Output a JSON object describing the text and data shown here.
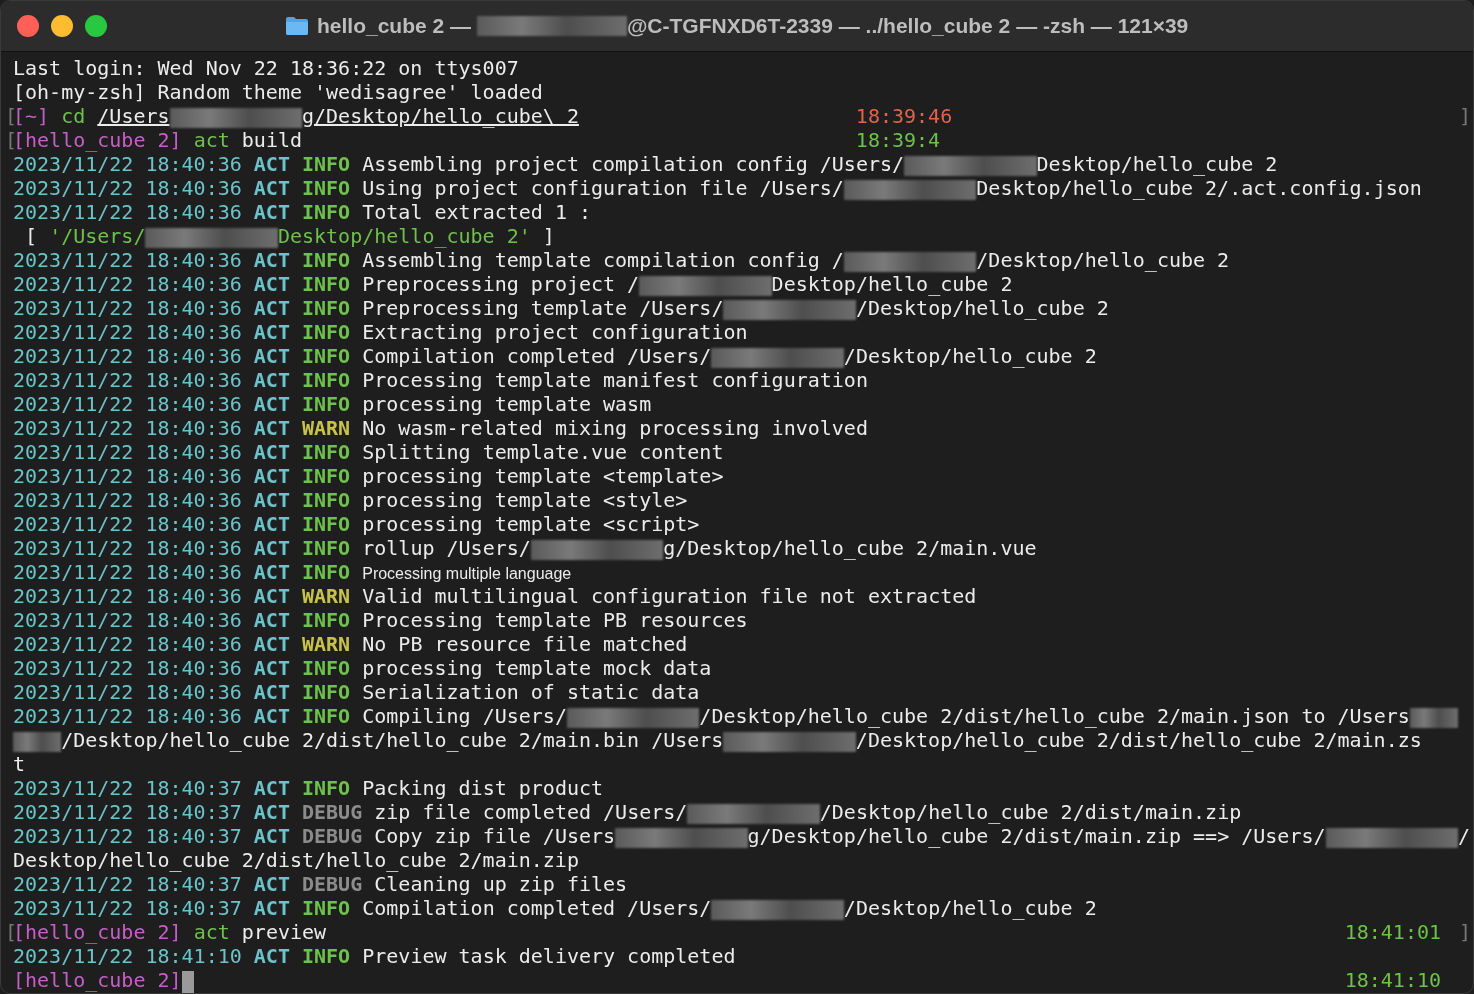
{
  "window": {
    "title_parts": [
      {
        "kind": "text",
        "text": "hello_cube 2 — "
      },
      {
        "kind": "redacted"
      },
      {
        "kind": "text",
        "text": "@C-TGFNXD6T-2339 — ../hello_cube 2 — -zsh — 121×39"
      }
    ]
  },
  "lines": [
    {
      "kind": "text",
      "parts": [
        {
          "kind": "text",
          "text": "Last login: Wed Nov 22 18:36:22 on ttys007"
        }
      ]
    },
    {
      "kind": "text",
      "parts": [
        {
          "kind": "text",
          "text": "[oh-my-zsh] Random theme 'wedisagree' loaded"
        }
      ]
    },
    {
      "kind": "prompt_narrow",
      "lbracket": "[",
      "dir": "[~]",
      "command": "cd",
      "args": [
        {
          "kind": "text",
          "text": "/Users",
          "underlined": true
        },
        {
          "kind": "redacted"
        },
        {
          "kind": "text",
          "text": "g/Desktop/hello_cube\\ 2",
          "underlined": true
        }
      ],
      "time": {
        "text": "18:39:46",
        "color": "#e0644c"
      },
      "rbracket": "]"
    },
    {
      "kind": "prompt_narrow",
      "lbracket": "[",
      "dir": "[hello_cube 2]",
      "command": "act",
      "args": [
        {
          "kind": "text",
          "text": "build",
          "underlined": false
        }
      ],
      "time": {
        "text": "18:39:4",
        "color": "#6cc24a"
      }
    },
    {
      "kind": "log",
      "time": "2023/11/22 18:40:36",
      "source": "ACT",
      "severity": {
        "label": "INFO",
        "color": "#6cc24a"
      },
      "parts": [
        {
          "kind": "text",
          "text": "Assembling project compilation config /Users/"
        },
        {
          "kind": "redacted"
        },
        {
          "kind": "text",
          "text": "Desktop/hello_cube 2"
        }
      ]
    },
    {
      "kind": "log",
      "time": "2023/11/22 18:40:36",
      "source": "ACT",
      "severity": {
        "label": "INFO",
        "color": "#6cc24a"
      },
      "parts": [
        {
          "kind": "text",
          "text": "Using project configuration file /Users/"
        },
        {
          "kind": "redacted"
        },
        {
          "kind": "text",
          "text": "Desktop/hello_cube 2/.act.config.json"
        }
      ]
    },
    {
      "kind": "log",
      "time": "2023/11/22 18:40:36",
      "source": "ACT",
      "severity": {
        "label": "INFO",
        "color": "#6cc24a"
      },
      "parts": [
        {
          "kind": "text",
          "text": "Total extracted 1 :"
        }
      ]
    },
    {
      "kind": "text",
      "parts": [
        {
          "kind": "text",
          "text": " [ "
        },
        {
          "kind": "text",
          "text": "'/Users/",
          "color": "#6cc24a"
        },
        {
          "kind": "redacted"
        },
        {
          "kind": "text",
          "text": "Desktop/hello_cube 2'",
          "color": "#6cc24a"
        },
        {
          "kind": "text",
          "text": " ]"
        }
      ]
    },
    {
      "kind": "log",
      "time": "2023/11/22 18:40:36",
      "source": "ACT",
      "severity": {
        "label": "INFO",
        "color": "#6cc24a"
      },
      "parts": [
        {
          "kind": "text",
          "text": "Assembling template compilation config /"
        },
        {
          "kind": "redacted"
        },
        {
          "kind": "text",
          "text": "/Desktop/hello_cube 2"
        }
      ]
    },
    {
      "kind": "log",
      "time": "2023/11/22 18:40:36",
      "source": "ACT",
      "severity": {
        "label": "INFO",
        "color": "#6cc24a"
      },
      "parts": [
        {
          "kind": "text",
          "text": "Preprocessing project /"
        },
        {
          "kind": "redacted"
        },
        {
          "kind": "text",
          "text": "Desktop/hello_cube 2"
        }
      ]
    },
    {
      "kind": "log",
      "time": "2023/11/22 18:40:36",
      "source": "ACT",
      "severity": {
        "label": "INFO",
        "color": "#6cc24a"
      },
      "parts": [
        {
          "kind": "text",
          "text": "Preprocessing template /Users/"
        },
        {
          "kind": "redacted"
        },
        {
          "kind": "text",
          "text": "/Desktop/hello_cube 2"
        }
      ]
    },
    {
      "kind": "log",
      "time": "2023/11/22 18:40:36",
      "source": "ACT",
      "severity": {
        "label": "INFO",
        "color": "#6cc24a"
      },
      "parts": [
        {
          "kind": "text",
          "text": "Extracting project configuration"
        }
      ]
    },
    {
      "kind": "log",
      "time": "2023/11/22 18:40:36",
      "source": "ACT",
      "severity": {
        "label": "INFO",
        "color": "#6cc24a"
      },
      "parts": [
        {
          "kind": "text",
          "text": "Compilation completed /Users/"
        },
        {
          "kind": "redacted"
        },
        {
          "kind": "text",
          "text": "/Desktop/hello_cube 2"
        }
      ]
    },
    {
      "kind": "log",
      "time": "2023/11/22 18:40:36",
      "source": "ACT",
      "severity": {
        "label": "INFO",
        "color": "#6cc24a"
      },
      "parts": [
        {
          "kind": "text",
          "text": "Processing template manifest configuration"
        }
      ]
    },
    {
      "kind": "log",
      "time": "2023/11/22 18:40:36",
      "source": "ACT",
      "severity": {
        "label": "INFO",
        "color": "#6cc24a"
      },
      "parts": [
        {
          "kind": "text",
          "text": "processing template wasm"
        }
      ]
    },
    {
      "kind": "log",
      "time": "2023/11/22 18:40:36",
      "source": "ACT",
      "severity": {
        "label": "WARN",
        "color": "#c9c24a"
      },
      "parts": [
        {
          "kind": "text",
          "text": "No wasm-related mixing processing involved"
        }
      ]
    },
    {
      "kind": "log",
      "time": "2023/11/22 18:40:36",
      "source": "ACT",
      "severity": {
        "label": "INFO",
        "color": "#6cc24a"
      },
      "parts": [
        {
          "kind": "text",
          "text": "Splitting template.vue content"
        }
      ]
    },
    {
      "kind": "log",
      "time": "2023/11/22 18:40:36",
      "source": "ACT",
      "severity": {
        "label": "INFO",
        "color": "#6cc24a"
      },
      "parts": [
        {
          "kind": "text",
          "text": "processing template <template>"
        }
      ]
    },
    {
      "kind": "log",
      "time": "2023/11/22 18:40:36",
      "source": "ACT",
      "severity": {
        "label": "INFO",
        "color": "#6cc24a"
      },
      "parts": [
        {
          "kind": "text",
          "text": "processing template <style>"
        }
      ]
    },
    {
      "kind": "log",
      "time": "2023/11/22 18:40:36",
      "source": "ACT",
      "severity": {
        "label": "INFO",
        "color": "#6cc24a"
      },
      "parts": [
        {
          "kind": "text",
          "text": "processing template <script>"
        }
      ]
    },
    {
      "kind": "log",
      "time": "2023/11/22 18:40:36",
      "source": "ACT",
      "severity": {
        "label": "INFO",
        "color": "#6cc24a"
      },
      "parts": [
        {
          "kind": "text",
          "text": "rollup /Users/"
        },
        {
          "kind": "redacted"
        },
        {
          "kind": "text",
          "text": "g/Desktop/hello_cube 2/main.vue"
        }
      ]
    },
    {
      "kind": "log",
      "time": "2023/11/22 18:40:36",
      "source": "ACT",
      "severity": {
        "label": "INFO",
        "color": "#6cc24a"
      },
      "parts": [
        {
          "kind": "sans",
          "text": "Processing multiple language"
        }
      ]
    },
    {
      "kind": "log",
      "time": "2023/11/22 18:40:36",
      "source": "ACT",
      "severity": {
        "label": "WARN",
        "color": "#c9c24a"
      },
      "parts": [
        {
          "kind": "text",
          "text": "Valid multilingual configuration file not extracted"
        }
      ]
    },
    {
      "kind": "log",
      "time": "2023/11/22 18:40:36",
      "source": "ACT",
      "severity": {
        "label": "INFO",
        "color": "#6cc24a"
      },
      "parts": [
        {
          "kind": "text",
          "text": "Processing template PB resources"
        }
      ]
    },
    {
      "kind": "log",
      "time": "2023/11/22 18:40:36",
      "source": "ACT",
      "severity": {
        "label": "WARN",
        "color": "#c9c24a"
      },
      "parts": [
        {
          "kind": "text",
          "text": "No PB resource file matched"
        }
      ]
    },
    {
      "kind": "log",
      "time": "2023/11/22 18:40:36",
      "source": "ACT",
      "severity": {
        "label": "INFO",
        "color": "#6cc24a"
      },
      "parts": [
        {
          "kind": "text",
          "text": "processing template mock data"
        }
      ]
    },
    {
      "kind": "log",
      "time": "2023/11/22 18:40:36",
      "source": "ACT",
      "severity": {
        "label": "INFO",
        "color": "#6cc24a"
      },
      "parts": [
        {
          "kind": "text",
          "text": "Serialization of static data"
        }
      ]
    },
    {
      "kind": "log",
      "time": "2023/11/22 18:40:36",
      "source": "ACT",
      "severity": {
        "label": "INFO",
        "color": "#6cc24a"
      },
      "parts": [
        {
          "kind": "text",
          "text": "Compiling /Users/"
        },
        {
          "kind": "redacted"
        },
        {
          "kind": "text",
          "text": "/Desktop/hello_cube 2/dist/hello_cube 2/main.json to /Users"
        },
        {
          "kind": "redacted_short"
        }
      ]
    },
    {
      "kind": "text",
      "parts": [
        {
          "kind": "redacted_short"
        },
        {
          "kind": "text",
          "text": "/Desktop/hello_cube 2/dist/hello_cube 2/main.bin /Users"
        },
        {
          "kind": "redacted"
        },
        {
          "kind": "text",
          "text": "/Desktop/hello_cube 2/dist/hello_cube 2/main.zs"
        }
      ]
    },
    {
      "kind": "text",
      "parts": [
        {
          "kind": "text",
          "text": "t"
        }
      ]
    },
    {
      "kind": "log",
      "time": "2023/11/22 18:40:37",
      "source": "ACT",
      "severity": {
        "label": "INFO",
        "color": "#6cc24a"
      },
      "parts": [
        {
          "kind": "text",
          "text": "Packing dist product"
        }
      ]
    },
    {
      "kind": "log",
      "time": "2023/11/22 18:40:37",
      "source": "ACT",
      "severity": {
        "label": "DEBUG",
        "color": "#8c8c8c"
      },
      "parts": [
        {
          "kind": "text",
          "text": "zip file completed /Users/"
        },
        {
          "kind": "redacted"
        },
        {
          "kind": "text",
          "text": "/Desktop/hello_cube 2/dist/main.zip"
        }
      ]
    },
    {
      "kind": "log",
      "time": "2023/11/22 18:40:37",
      "source": "ACT",
      "severity": {
        "label": "DEBUG",
        "color": "#8c8c8c"
      },
      "parts": [
        {
          "kind": "text",
          "text": "Copy zip file /Users"
        },
        {
          "kind": "redacted"
        },
        {
          "kind": "text",
          "text": "g/Desktop/hello_cube 2/dist/main.zip ==> /Users/"
        },
        {
          "kind": "redacted"
        },
        {
          "kind": "text",
          "text": "/"
        }
      ]
    },
    {
      "kind": "text",
      "parts": [
        {
          "kind": "text",
          "text": "Desktop/hello_cube 2/dist/hello_cube 2/main.zip"
        }
      ]
    },
    {
      "kind": "log",
      "time": "2023/11/22 18:40:37",
      "source": "ACT",
      "severity": {
        "label": "DEBUG",
        "color": "#8c8c8c"
      },
      "parts": [
        {
          "kind": "text",
          "text": "Cleaning up zip files"
        }
      ]
    },
    {
      "kind": "log",
      "time": "2023/11/22 18:40:37",
      "source": "ACT",
      "severity": {
        "label": "INFO",
        "color": "#6cc24a"
      },
      "parts": [
        {
          "kind": "text",
          "text": "Compilation completed /Users/"
        },
        {
          "kind": "redacted"
        },
        {
          "kind": "text",
          "text": "/Desktop/hello_cube 2"
        }
      ]
    },
    {
      "kind": "prompt",
      "lbracket": "[",
      "dir": "[hello_cube 2]",
      "command": "act",
      "args": [
        {
          "kind": "text",
          "text": "preview",
          "underlined": false
        }
      ],
      "time": {
        "text": "18:41:01",
        "color": "#6cc24a"
      },
      "rbracket": "]"
    },
    {
      "kind": "log",
      "time": "2023/11/22 18:41:10",
      "source": "ACT",
      "severity": {
        "label": "INFO",
        "color": "#6cc24a"
      },
      "parts": [
        {
          "kind": "text",
          "text": "Preview task delivery completed"
        }
      ]
    },
    {
      "kind": "prompt",
      "dir": "[hello_cube 2]",
      "cursor": true,
      "time": {
        "text": "18:41:10",
        "color": "#6cc24a"
      }
    }
  ]
}
